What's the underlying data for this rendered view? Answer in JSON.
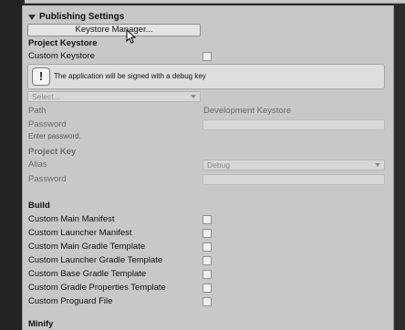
{
  "publishing": {
    "title": "Publishing Settings",
    "keystore_manager_button": "Keystore Manager..."
  },
  "project_keystore": {
    "heading": "Project Keystore",
    "custom_keystore_label": "Custom Keystore",
    "custom_keystore_checked": false,
    "help_text": "The application will be signed with a debug key",
    "select_placeholder": "Select...",
    "path_label": "Path",
    "path_value": "Development Keystore",
    "password_label": "Password",
    "password_hint": "Enter password."
  },
  "project_key": {
    "heading": "Project Key",
    "alias_label": "Alias",
    "alias_value": "Debug",
    "password_label": "Password"
  },
  "build": {
    "heading": "Build",
    "options": [
      {
        "label": "Custom Main Manifest",
        "checked": false
      },
      {
        "label": "Custom Launcher Manifest",
        "checked": false
      },
      {
        "label": "Custom Main Gradle Template",
        "checked": false
      },
      {
        "label": "Custom Launcher Gradle Template",
        "checked": false
      },
      {
        "label": "Custom Base Gradle Template",
        "checked": false
      },
      {
        "label": "Custom Gradle Properties Template",
        "checked": false
      },
      {
        "label": "Custom Proguard File",
        "checked": false
      }
    ]
  },
  "minify": {
    "heading": "Minify"
  }
}
